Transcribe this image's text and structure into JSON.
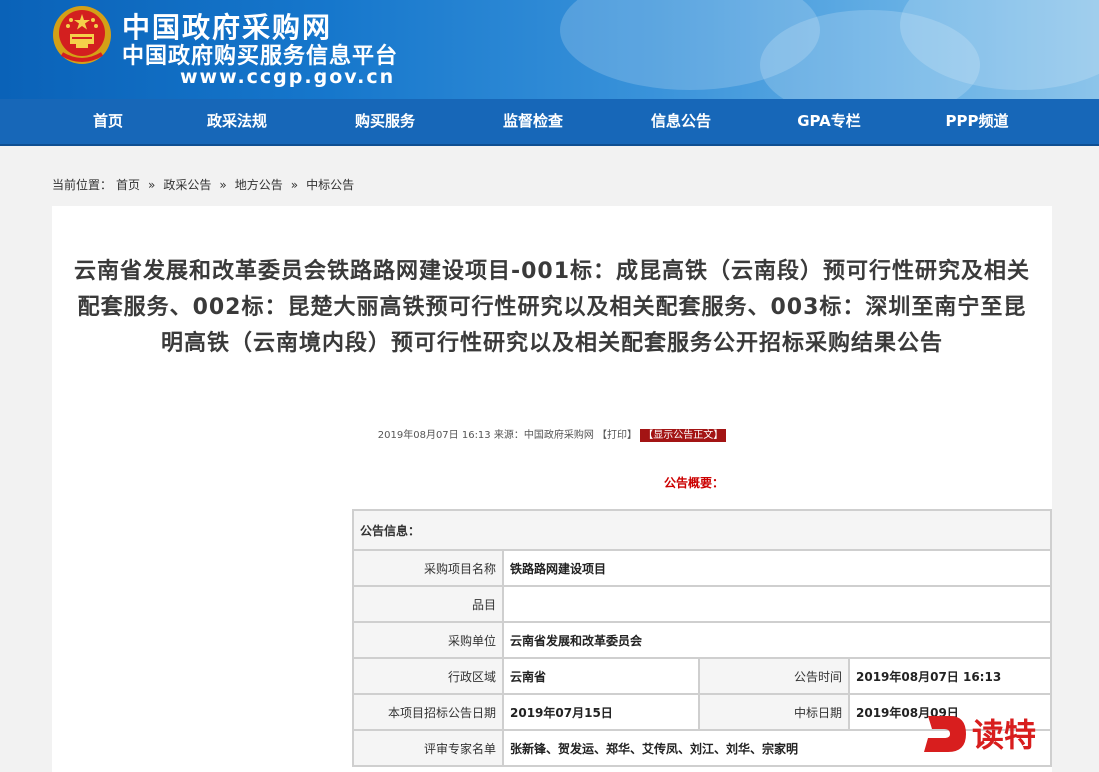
{
  "header": {
    "site_name": "中国政府采购网",
    "site_subtitle": "中国政府购买服务信息平台",
    "site_url": "www.ccgp.gov.cn"
  },
  "nav": {
    "items": [
      {
        "label": "首页"
      },
      {
        "label": "政采法规"
      },
      {
        "label": "购买服务"
      },
      {
        "label": "监督检查"
      },
      {
        "label": "信息公告"
      },
      {
        "label": "GPA专栏"
      },
      {
        "label": "PPP频道"
      }
    ]
  },
  "breadcrumb": {
    "prefix": "当前位置：",
    "items": [
      "首页",
      "政采公告",
      "地方公告",
      "中标公告"
    ],
    "separator": "»"
  },
  "article": {
    "title": "云南省发展和改革委员会铁路路网建设项目-001标：成昆高铁（云南段）预可行性研究及相关配套服务、002标：昆楚大丽高铁预可行性研究以及相关配套服务、003标：深圳至南宁至昆明高铁（云南境内段）预可行性研究以及相关配套服务公开招标采购结果公告",
    "meta_text": "2019年08月07日 16:13 来源：中国政府采购网 ",
    "print_label": "【打印】",
    "show_full_label": "【显示公告正文】",
    "summary_label": "公告概要："
  },
  "info_table": {
    "header": "公告信息：",
    "project_name_label": "采购项目名称",
    "project_name": "铁路路网建设项目",
    "item_label": "品目",
    "item_value": "",
    "purchaser_label": "采购单位",
    "purchaser": "云南省发展和改革委员会",
    "region_label": "行政区域",
    "region": "云南省",
    "publish_time_label": "公告时间",
    "publish_time": "2019年08月07日  16:13",
    "tender_date_label": "本项目招标公告日期",
    "tender_date": "2019年07月15日",
    "award_date_label": "中标日期",
    "award_date": "2019年08月09日",
    "experts_label": "评审专家名单",
    "experts": "张新锋、贺发运、郑华、艾传凤、刘江、刘华、宗家明"
  },
  "watermark": {
    "text": "读特"
  },
  "colors": {
    "nav_bg": "#1767b8",
    "accent_red": "#c00000",
    "header_blue": "#0a62b8"
  }
}
